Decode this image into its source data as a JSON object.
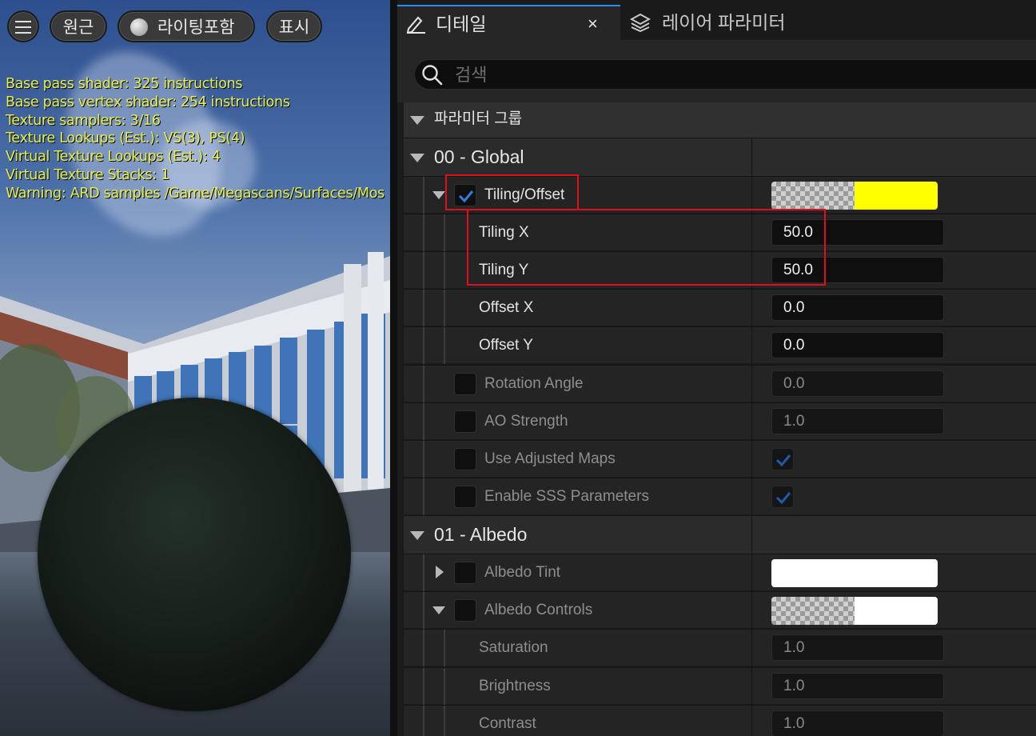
{
  "viewport": {
    "menu_icon": "hamburger-icon",
    "buttons": {
      "perspective": "원근",
      "lighting": "라이팅포함",
      "show": "표시"
    },
    "stats": [
      "Base pass shader: 325 instructions",
      "Base pass vertex shader: 254 instructions",
      "Texture samplers: 3/16",
      "Texture Lookups (Est.): VS(3), PS(4)",
      "Virtual Texture Lookups (Est.): 4",
      "Virtual Texture Stacks: 1",
      "Warning: ARD samples /Game/Megascans/Surfaces/Mos"
    ],
    "stats_color": "#e9ef4a"
  },
  "tabs": {
    "details": {
      "label": "디테일",
      "icon": "pencil-icon",
      "close": "×"
    },
    "layer_params": {
      "label": "레이어 파라미터",
      "icon": "layers-icon"
    }
  },
  "search": {
    "placeholder": "검색",
    "icon": "search-icon"
  },
  "param_group": {
    "label": "파라미터 그룹"
  },
  "groups": {
    "global": {
      "label": "00 - Global"
    },
    "albedo": {
      "label": "01 - Albedo"
    }
  },
  "params": {
    "tiling_offset": {
      "label": "Tiling/Offset",
      "checked": true,
      "swatch_color": "#ffff00"
    },
    "tiling_x": {
      "label": "Tiling X",
      "value": "50.0"
    },
    "tiling_y": {
      "label": "Tiling Y",
      "value": "50.0"
    },
    "offset_x": {
      "label": "Offset X",
      "value": "0.0"
    },
    "offset_y": {
      "label": "Offset Y",
      "value": "0.0"
    },
    "rotation_angle": {
      "label": "Rotation Angle",
      "value": "0.0",
      "checked": false
    },
    "ao_strength": {
      "label": "AO Strength",
      "value": "1.0",
      "checked": false
    },
    "use_adjusted_maps": {
      "label": "Use Adjusted Maps",
      "checked": false,
      "value_checked": true
    },
    "enable_sss": {
      "label": "Enable SSS Parameters",
      "checked": false,
      "value_checked": true
    },
    "albedo_tint": {
      "label": "Albedo Tint",
      "checked": false,
      "swatch_color": "#ffffff"
    },
    "albedo_controls": {
      "label": "Albedo Controls",
      "checked": false,
      "swatch_color": "#ffffff"
    },
    "saturation": {
      "label": "Saturation",
      "value": "1.0"
    },
    "brightness": {
      "label": "Brightness",
      "value": "1.0"
    },
    "contrast": {
      "label": "Contrast",
      "value": "1.0"
    }
  },
  "colors": {
    "highlight": "#e0101a",
    "accent_blue": "#2a8cf0",
    "check_blue": "#2f7fe0"
  }
}
